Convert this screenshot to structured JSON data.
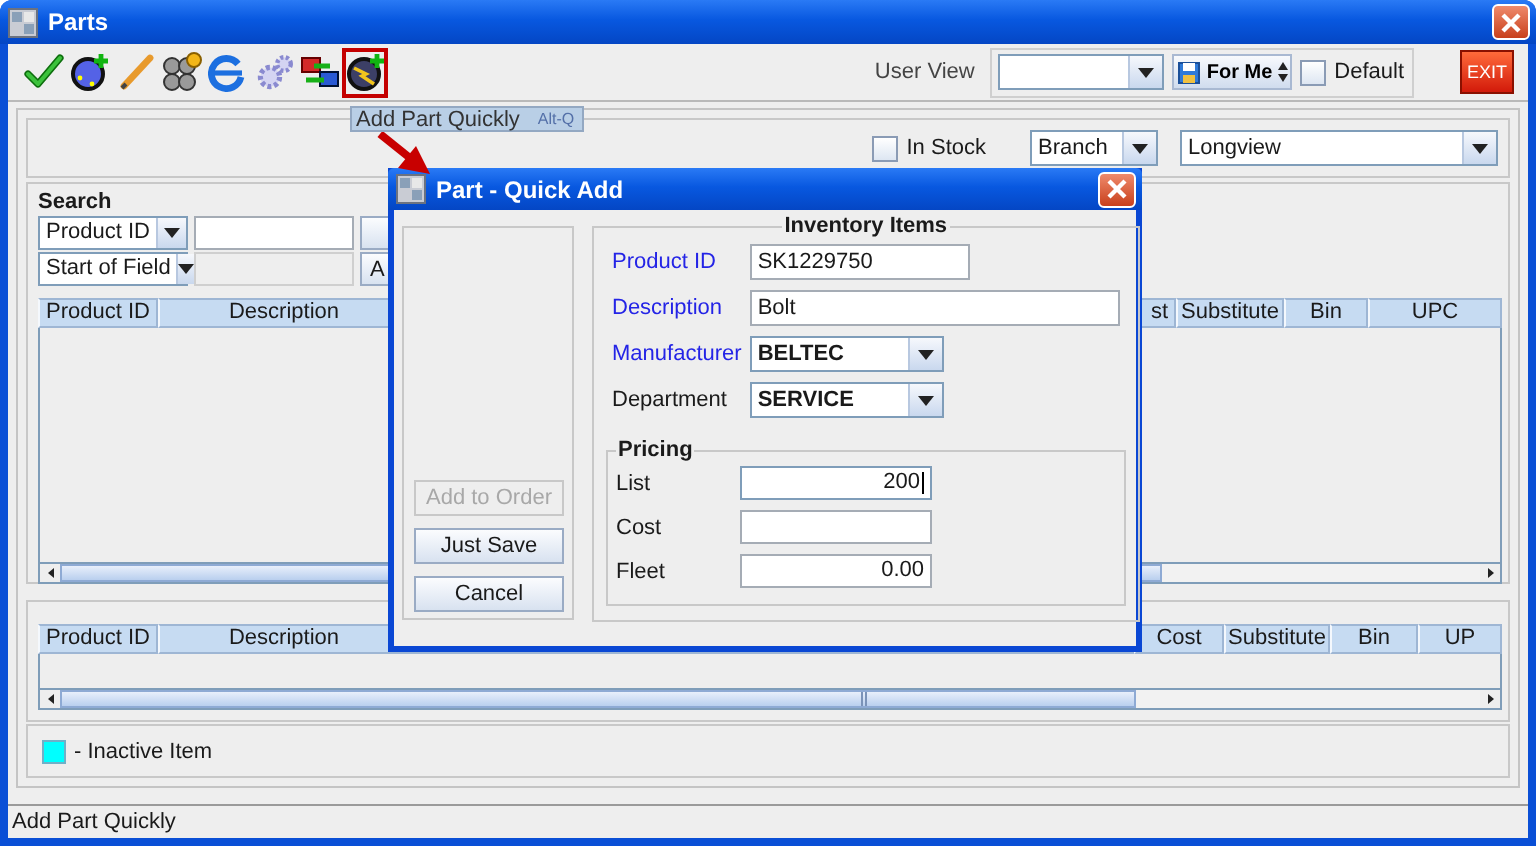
{
  "window": {
    "title": "Parts"
  },
  "toolbar": {
    "tools": [
      {
        "kind": "check",
        "highlighted": false
      },
      {
        "kind": "globe_add",
        "highlighted": false
      },
      {
        "kind": "pencil",
        "highlighted": false
      },
      {
        "kind": "spheres",
        "highlighted": false
      },
      {
        "kind": "browser",
        "highlighted": false
      },
      {
        "kind": "gears",
        "highlighted": false
      },
      {
        "kind": "transfer",
        "highlighted": false
      },
      {
        "kind": "quick_add",
        "highlighted": true
      }
    ],
    "user_view_label": "User View",
    "for_me": "For Me",
    "default": {
      "label": "Default",
      "checked": false
    },
    "exit": "EXIT"
  },
  "tooltip": {
    "text": "Add Part Quickly",
    "shortcut": "Alt-Q"
  },
  "filters": {
    "in_stock": {
      "label": "In Stock",
      "checked": false
    },
    "scope": "Branch",
    "location": "Longview"
  },
  "search": {
    "title": "Search",
    "rows": [
      {
        "combo": "Product ID",
        "input_disabled": false
      },
      {
        "combo": "Start of Field",
        "input_disabled": true,
        "button": "A"
      }
    ]
  },
  "results_table": {
    "columns": [
      "Product ID",
      "Description",
      "st",
      "Substitute",
      "Bin",
      "UPC"
    ]
  },
  "detail_table": {
    "columns": [
      "Product ID",
      "Description",
      "Cost",
      "Substitute",
      "Bin",
      "UP"
    ]
  },
  "legend": {
    "color": "#00ffff",
    "label": "- Inactive Item"
  },
  "status_bar": "Add Part Quickly",
  "dialog": {
    "title": "Part - Quick Add",
    "actions": [
      {
        "label": "Add to Order",
        "disabled": true
      },
      {
        "label": "Just Save",
        "disabled": false
      },
      {
        "label": "Cancel",
        "disabled": false
      }
    ],
    "inventory": {
      "title": "Inventory Items",
      "fields": [
        {
          "kind": "text",
          "label": "Product ID",
          "required": true,
          "value": "SK1229750"
        },
        {
          "kind": "text",
          "label": "Description",
          "required": true,
          "value": "Bolt"
        },
        {
          "kind": "combo",
          "label": "Manufacturer",
          "required": true,
          "value": "BELTEC"
        },
        {
          "kind": "combo",
          "label": "Department",
          "required": false,
          "value": "SERVICE"
        }
      ]
    },
    "pricing": {
      "title": "Pricing",
      "fields": [
        {
          "label": "List",
          "value": "200",
          "focused": true
        },
        {
          "label": "Cost",
          "focused": false
        },
        {
          "label": "Fleet",
          "value": "0.00",
          "focused": false
        }
      ]
    }
  }
}
